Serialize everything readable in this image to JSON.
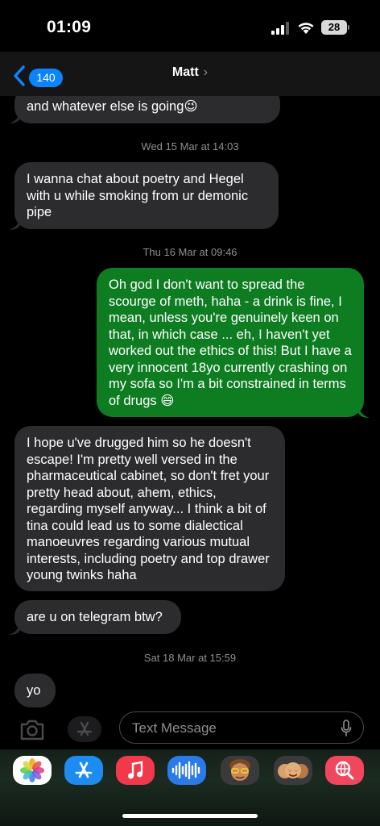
{
  "status_bar": {
    "time": "01:09",
    "battery": "28"
  },
  "nav": {
    "badge_count": "140",
    "contact_name": "Matt"
  },
  "messages": [
    {
      "type": "incoming",
      "text": "and whatever else is going😉"
    },
    {
      "type": "timestamp",
      "text": "Wed 15 Mar at 14:03"
    },
    {
      "type": "incoming",
      "text": "I wanna chat about poetry and Hegel with u while smoking from ur demonic pipe"
    },
    {
      "type": "timestamp",
      "text": "Thu 16 Mar at 09:46"
    },
    {
      "type": "outgoing",
      "text": "Oh god I don't want to spread the scourge of meth, haha - a drink is fine, I mean, unless you're genuinely keen on that, in which case ... eh, I haven't yet worked out the ethics of this! But I have a very innocent 18yo currently crashing on my sofa so I'm a bit constrained in terms of drugs 😄"
    },
    {
      "type": "incoming",
      "text": "I hope u've drugged him so he doesn't escape! I'm pretty well versed in the pharmaceutical cabinet, so don't fret your pretty head about, ahem, ethics, regarding myself anyway... I think a bit of tina could lead us to some dialectical manoeuvres regarding various mutual interests, including poetry and top drawer young twinks haha"
    },
    {
      "type": "incoming",
      "text": "are u on telegram btw?"
    },
    {
      "type": "timestamp",
      "text": "Sat 18 Mar at 15:59"
    },
    {
      "type": "incoming",
      "text": "yo"
    }
  ],
  "input": {
    "placeholder": "Text Message"
  },
  "apps": [
    {
      "name": "photos-app-icon"
    },
    {
      "name": "app-store-icon"
    },
    {
      "name": "music-app-icon"
    },
    {
      "name": "audio-message-icon"
    },
    {
      "name": "memoji-icon"
    },
    {
      "name": "memoji-stickers-icon"
    },
    {
      "name": "images-search-icon"
    }
  ],
  "colors": {
    "incoming": "#2c2c2e",
    "outgoing": "#0e7d22",
    "accent": "#0a84ff"
  }
}
